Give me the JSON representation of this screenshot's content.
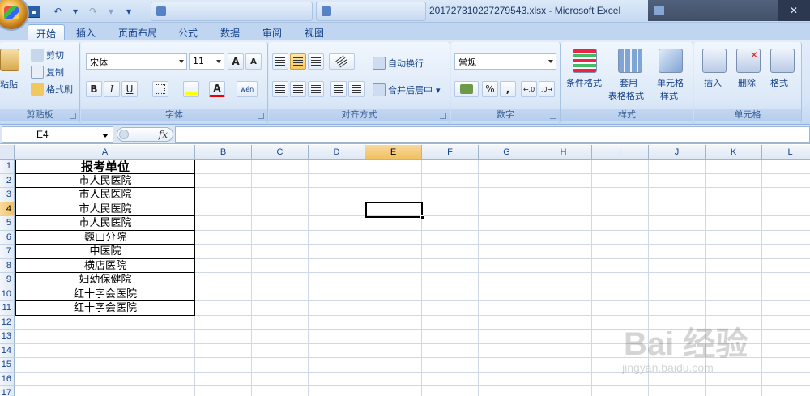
{
  "window": {
    "title": "201727310227279543.xlsx - Microsoft Excel",
    "close_glyph": "✕"
  },
  "taskbar": {
    "tabs": [
      "",
      "",
      "",
      ""
    ]
  },
  "quick_access": {
    "undo_glyph": "↶",
    "redo_glyph": "↷",
    "dropdown_glyph": "▾"
  },
  "ribbon_tabs": [
    "开始",
    "插入",
    "页面布局",
    "公式",
    "数据",
    "审阅",
    "视图"
  ],
  "ribbon": {
    "clipboard": {
      "label": "剪贴板",
      "paste": "粘贴",
      "cut": "剪切",
      "copy": "复制",
      "format_painter": "格式刷"
    },
    "font": {
      "label": "字体",
      "font_name": "宋体",
      "font_size": "11",
      "grow": "A",
      "shrink": "A",
      "bold": "B",
      "italic": "I",
      "underline": "U",
      "font_color": "A",
      "phonetic": "wén"
    },
    "alignment": {
      "label": "对齐方式",
      "wrap": "自动换行",
      "merge": "合并后居中"
    },
    "number": {
      "label": "数字",
      "format": "常规",
      "percent": "%",
      "comma": ","
    },
    "styles": {
      "label": "样式",
      "conditional": "条件格式",
      "table_line1": "套用",
      "table_line2": "表格格式",
      "cell_line1": "单元格",
      "cell_line2": "样式"
    },
    "cells": {
      "label": "单元格",
      "insert": "插入",
      "delete": "删除",
      "format": "格式"
    }
  },
  "formula_bar": {
    "name_box": "E4",
    "fx": "fx",
    "content": ""
  },
  "sheet": {
    "columns": [
      "A",
      "B",
      "C",
      "D",
      "E",
      "F",
      "G",
      "H",
      "I",
      "J",
      "K",
      "L"
    ],
    "selected_column": "E",
    "rows": [
      "1",
      "2",
      "3",
      "4",
      "5",
      "6",
      "7",
      "8",
      "9",
      "10",
      "11",
      "12",
      "13",
      "14",
      "15",
      "16",
      "17"
    ],
    "selected_row": "4",
    "column_a": [
      "报考单位",
      "市人民医院",
      "市人民医院",
      "市人民医院",
      "市人民医院",
      "巍山分院",
      "中医院",
      "横店医院",
      "妇幼保健院",
      "红十字会医院",
      "红十字会医院"
    ]
  },
  "watermark": {
    "big": "Bai 经验",
    "small": "jingyan.baidu.com"
  }
}
